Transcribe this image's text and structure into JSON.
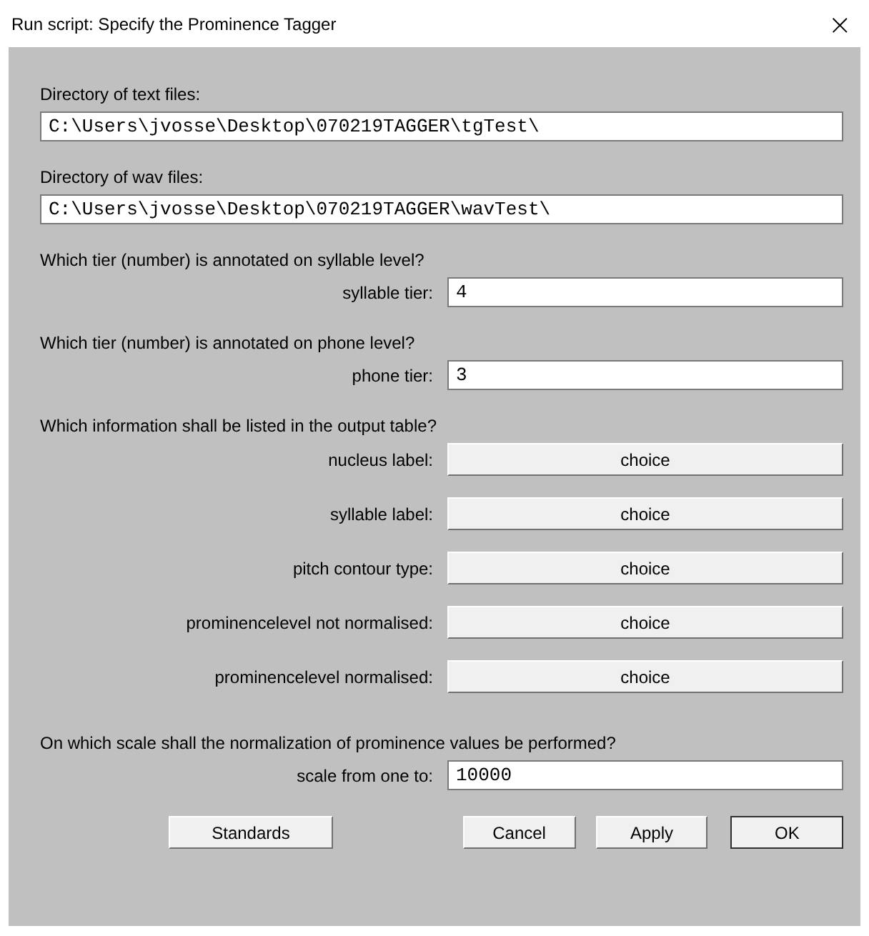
{
  "window": {
    "title": "Run script: Specify the Prominence Tagger",
    "close": "×"
  },
  "sections": [
    {
      "heading": "Directory of text files:",
      "items": [
        {
          "kind": "path",
          "value": "C:\\Users\\jvosse\\Desktop\\070219TAGGER\\tgTest\\"
        }
      ]
    },
    {
      "heading": "Directory of wav files:",
      "items": [
        {
          "kind": "path",
          "value": "C:\\Users\\jvosse\\Desktop\\070219TAGGER\\wavTest\\"
        }
      ]
    },
    {
      "heading": "Which tier (number) is annotated on syllable level?",
      "items": [
        {
          "kind": "field",
          "label": "syllable tier:",
          "value": "4"
        }
      ]
    },
    {
      "heading": "Which tier (number) is annotated on phone level?",
      "items": [
        {
          "kind": "field",
          "label": "phone tier:",
          "value": "3"
        }
      ]
    },
    {
      "heading": "Which information shall be listed in the output table?",
      "items": [
        {
          "kind": "choice",
          "label": "nucleus label:",
          "value": "choice"
        },
        {
          "kind": "choice",
          "label": "syllable label:",
          "value": "choice"
        },
        {
          "kind": "choice",
          "label": "pitch contour type:",
          "value": "choice"
        },
        {
          "kind": "choice",
          "label": "prominencelevel not normalised:",
          "value": "choice"
        },
        {
          "kind": "choice",
          "label": "prominencelevel normalised:",
          "value": "choice"
        }
      ]
    },
    {
      "heading": "On which scale shall the normalization of prominence values be performed?",
      "items": [
        {
          "kind": "field",
          "label": "scale from one to:",
          "value": "10000"
        }
      ]
    }
  ],
  "buttons": [
    {
      "label": "Standards",
      "default": false
    },
    {
      "label": "Cancel",
      "default": false
    },
    {
      "label": "Apply",
      "default": false
    },
    {
      "label": "OK",
      "default": true
    }
  ]
}
